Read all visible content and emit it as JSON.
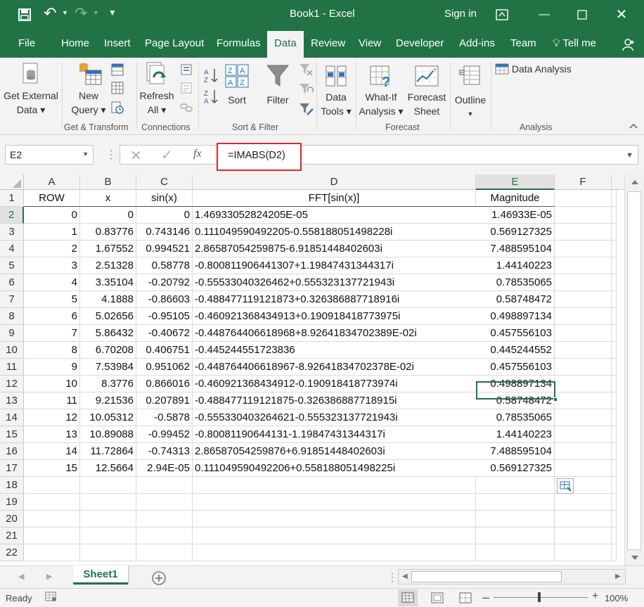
{
  "window": {
    "title": "Book1  -  Excel",
    "sign_in": "Sign in"
  },
  "tabs": [
    "File",
    "Home",
    "Insert",
    "Page Layout",
    "Formulas",
    "Data",
    "Review",
    "View",
    "Developer",
    "Add-ins",
    "Team",
    "Tell me"
  ],
  "active_tab": "Data",
  "ribbon": {
    "get_external_data": [
      "Get External",
      "Data ▾"
    ],
    "new_query": [
      "New",
      "Query ▾"
    ],
    "refresh_all": [
      "Refresh",
      "All ▾"
    ],
    "sort": "Sort",
    "filter": "Filter",
    "data_tools": [
      "Data",
      "Tools ▾"
    ],
    "what_if": [
      "What-If",
      "Analysis ▾"
    ],
    "forecast_sheet": [
      "Forecast",
      "Sheet"
    ],
    "outline": "Outline",
    "data_analysis": "Data Analysis",
    "groups": [
      "Get & Transform",
      "Connections",
      "Sort & Filter",
      "Forecast",
      "Analysis"
    ]
  },
  "formula_bar": {
    "name_box": "E2",
    "formula": "=IMABS(D2)"
  },
  "columns": [
    "A",
    "B",
    "C",
    "D",
    "E",
    "F"
  ],
  "rows": [
    "1",
    "2",
    "3",
    "4",
    "5",
    "6",
    "7",
    "8",
    "9",
    "10",
    "11",
    "12",
    "13",
    "14",
    "15",
    "16",
    "17",
    "18",
    "19",
    "20",
    "21",
    "22"
  ],
  "headers": [
    "ROW",
    "x",
    "sin(x)",
    "FFT[sin(x)]",
    "Magnitude"
  ],
  "table": [
    [
      "0",
      "0",
      "0",
      "1.46933052824205E-05",
      "1.46933E-05"
    ],
    [
      "1",
      "0.83776",
      "0.743146",
      "0.111049590492205-0.558188051498228i",
      "0.569127325"
    ],
    [
      "2",
      "1.67552",
      "0.994521",
      "2.86587054259875-6.91851448402603i",
      "7.488595104"
    ],
    [
      "3",
      "2.51328",
      "0.58778",
      "-0.800811906441307+1.19847431344317i",
      "1.44140223"
    ],
    [
      "4",
      "3.35104",
      "-0.20792",
      "-0.55533040326462+0.555323137721943i",
      "0.78535065"
    ],
    [
      "5",
      "4.1888",
      "-0.86603",
      "-0.488477119121873+0.326386887718916i",
      "0.58748472"
    ],
    [
      "6",
      "5.02656",
      "-0.95105",
      "-0.460921368434913+0.190918418773975i",
      "0.498897134"
    ],
    [
      "7",
      "5.86432",
      "-0.40672",
      "-0.448764406618968+8.92641834702389E-02i",
      "0.457556103"
    ],
    [
      "8",
      "6.70208",
      "0.406751",
      "-0.445244551723836",
      "0.445244552"
    ],
    [
      "9",
      "7.53984",
      "0.951062",
      "-0.448764406618967-8.92641834702378E-02i",
      "0.457556103"
    ],
    [
      "10",
      "8.3776",
      "0.866016",
      "-0.460921368434912-0.190918418773974i",
      "0.498897134"
    ],
    [
      "11",
      "9.21536",
      "0.207891",
      "-0.488477119121875-0.326386887718915i",
      "0.58748472"
    ],
    [
      "12",
      "10.05312",
      "-0.5878",
      "-0.555330403264621-0.555323137721943i",
      "0.78535065"
    ],
    [
      "13",
      "10.89088",
      "-0.99452",
      "-0.80081190644131-1.19847431344317i",
      "1.44140223"
    ],
    [
      "14",
      "11.72864",
      "-0.74313",
      "2.86587054259876+6.91851448402603i",
      "7.488595104"
    ],
    [
      "15",
      "12.5664",
      "2.94E-05",
      "0.111049590492206+0.558188051498225i",
      "0.569127325"
    ]
  ],
  "sheet_tab": "Sheet1",
  "status": {
    "ready": "Ready",
    "zoom": "100%"
  },
  "icons": [
    "save-icon",
    "undo-icon",
    "redo-icon",
    "customize-qat-icon",
    "ribbon-display-icon",
    "minimize-icon",
    "maximize-icon",
    "close-icon",
    "lightbulb-icon",
    "share-icon",
    "cancel-icon",
    "enter-icon",
    "fx-icon",
    "add-sheet-icon",
    "quick-analysis-icon"
  ],
  "colors": {
    "excel_green": "#217346",
    "highlight_red": "#e0262e"
  }
}
